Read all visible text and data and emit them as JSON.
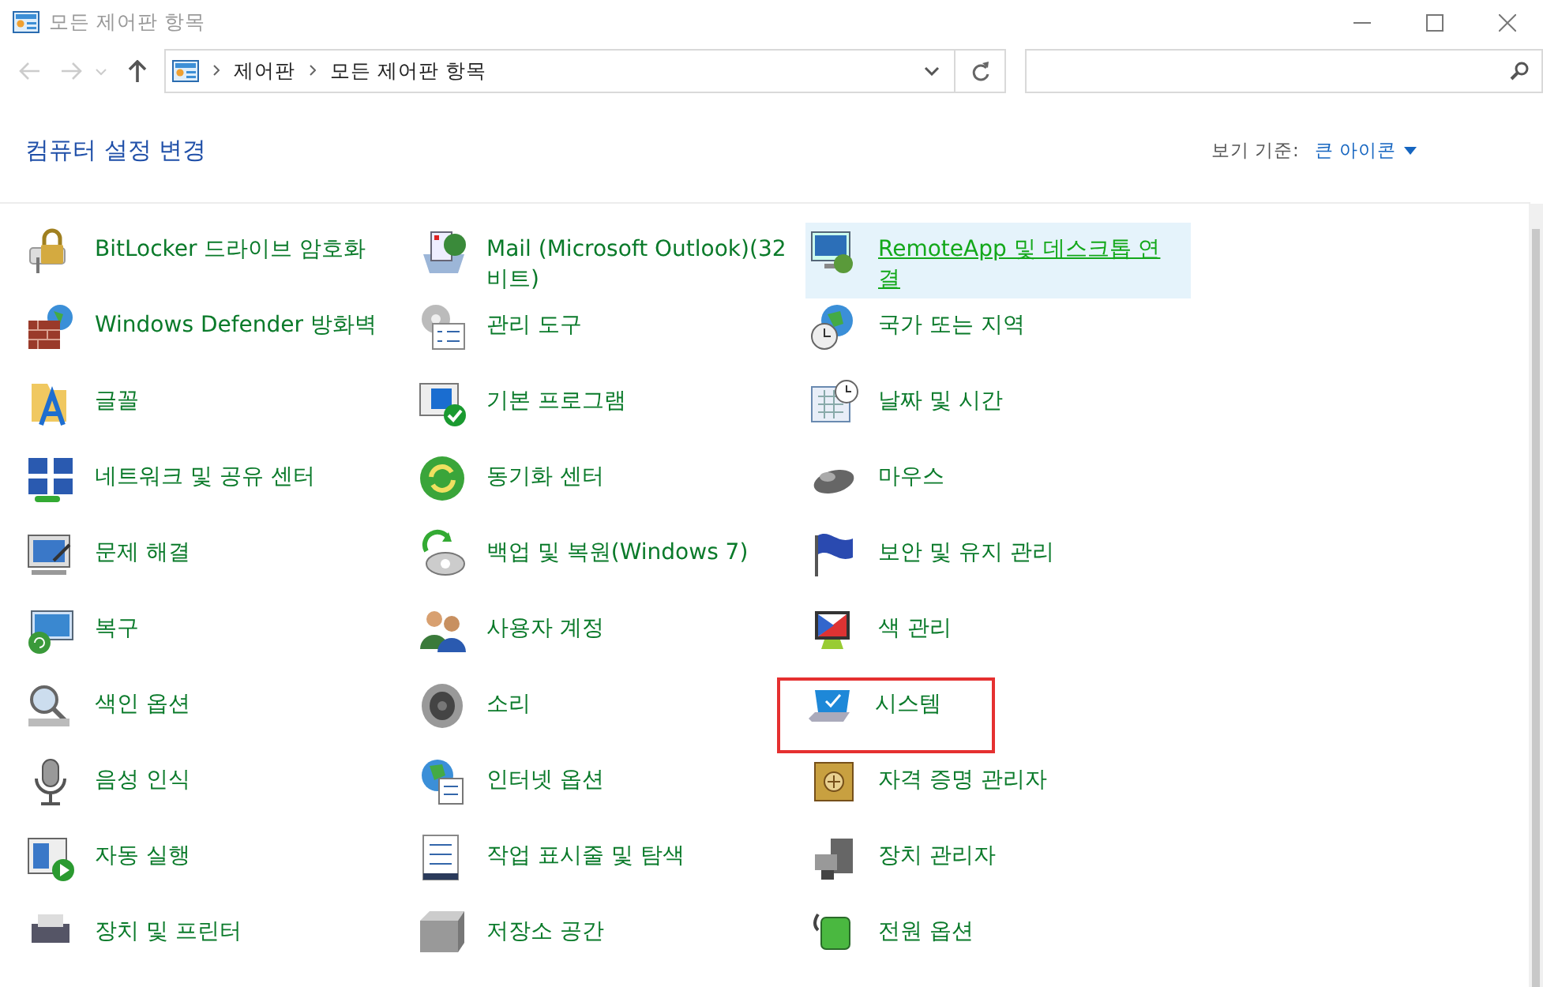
{
  "window": {
    "title": "모든 제어판 항목"
  },
  "nav": {
    "back_enabled": false,
    "forward_enabled": false
  },
  "address_bar": {
    "path": [
      "제어판",
      "모든 제어판 항목"
    ]
  },
  "header": {
    "title": "컴퓨터 설정 변경",
    "view_by_label": "보기 기준:",
    "view_by_value": "큰 아이콘"
  },
  "items": [
    {
      "label": "BitLocker 드라이브 암호화",
      "hovered": false,
      "highlighted": false
    },
    {
      "label": "Mail (Microsoft Outlook)(32비트)",
      "hovered": false,
      "highlighted": false
    },
    {
      "label": "RemoteApp 및 데스크톱 연결",
      "hovered": true,
      "highlighted": false
    },
    {
      "label": "Windows Defender 방화벽",
      "hovered": false,
      "highlighted": false
    },
    {
      "label": "관리 도구",
      "hovered": false,
      "highlighted": false
    },
    {
      "label": "국가 또는 지역",
      "hovered": false,
      "highlighted": false
    },
    {
      "label": "글꼴",
      "hovered": false,
      "highlighted": false
    },
    {
      "label": "기본 프로그램",
      "hovered": false,
      "highlighted": false
    },
    {
      "label": "날짜 및 시간",
      "hovered": false,
      "highlighted": false
    },
    {
      "label": "네트워크 및 공유 센터",
      "hovered": false,
      "highlighted": false
    },
    {
      "label": "동기화 센터",
      "hovered": false,
      "highlighted": false
    },
    {
      "label": "마우스",
      "hovered": false,
      "highlighted": false
    },
    {
      "label": "문제 해결",
      "hovered": false,
      "highlighted": false
    },
    {
      "label": "백업 및 복원(Windows 7)",
      "hovered": false,
      "highlighted": false
    },
    {
      "label": "보안 및 유지 관리",
      "hovered": false,
      "highlighted": false
    },
    {
      "label": "복구",
      "hovered": false,
      "highlighted": false
    },
    {
      "label": "사용자 계정",
      "hovered": false,
      "highlighted": false
    },
    {
      "label": "색 관리",
      "hovered": false,
      "highlighted": false
    },
    {
      "label": "색인 옵션",
      "hovered": false,
      "highlighted": false
    },
    {
      "label": "소리",
      "hovered": false,
      "highlighted": false
    },
    {
      "label": "시스템",
      "hovered": false,
      "highlighted": true
    },
    {
      "label": "음성 인식",
      "hovered": false,
      "highlighted": false
    },
    {
      "label": "인터넷 옵션",
      "hovered": false,
      "highlighted": false
    },
    {
      "label": "자격 증명 관리자",
      "hovered": false,
      "highlighted": false
    },
    {
      "label": "자동 실행",
      "hovered": false,
      "highlighted": false
    },
    {
      "label": "작업 표시줄 및 탐색",
      "hovered": false,
      "highlighted": false
    },
    {
      "label": "장치 관리자",
      "hovered": false,
      "highlighted": false
    },
    {
      "label": "장치 및 프린터",
      "hovered": false,
      "highlighted": false
    },
    {
      "label": "저장소 공간",
      "hovered": false,
      "highlighted": false
    },
    {
      "label": "전원 옵션",
      "hovered": false,
      "highlighted": false
    }
  ]
}
